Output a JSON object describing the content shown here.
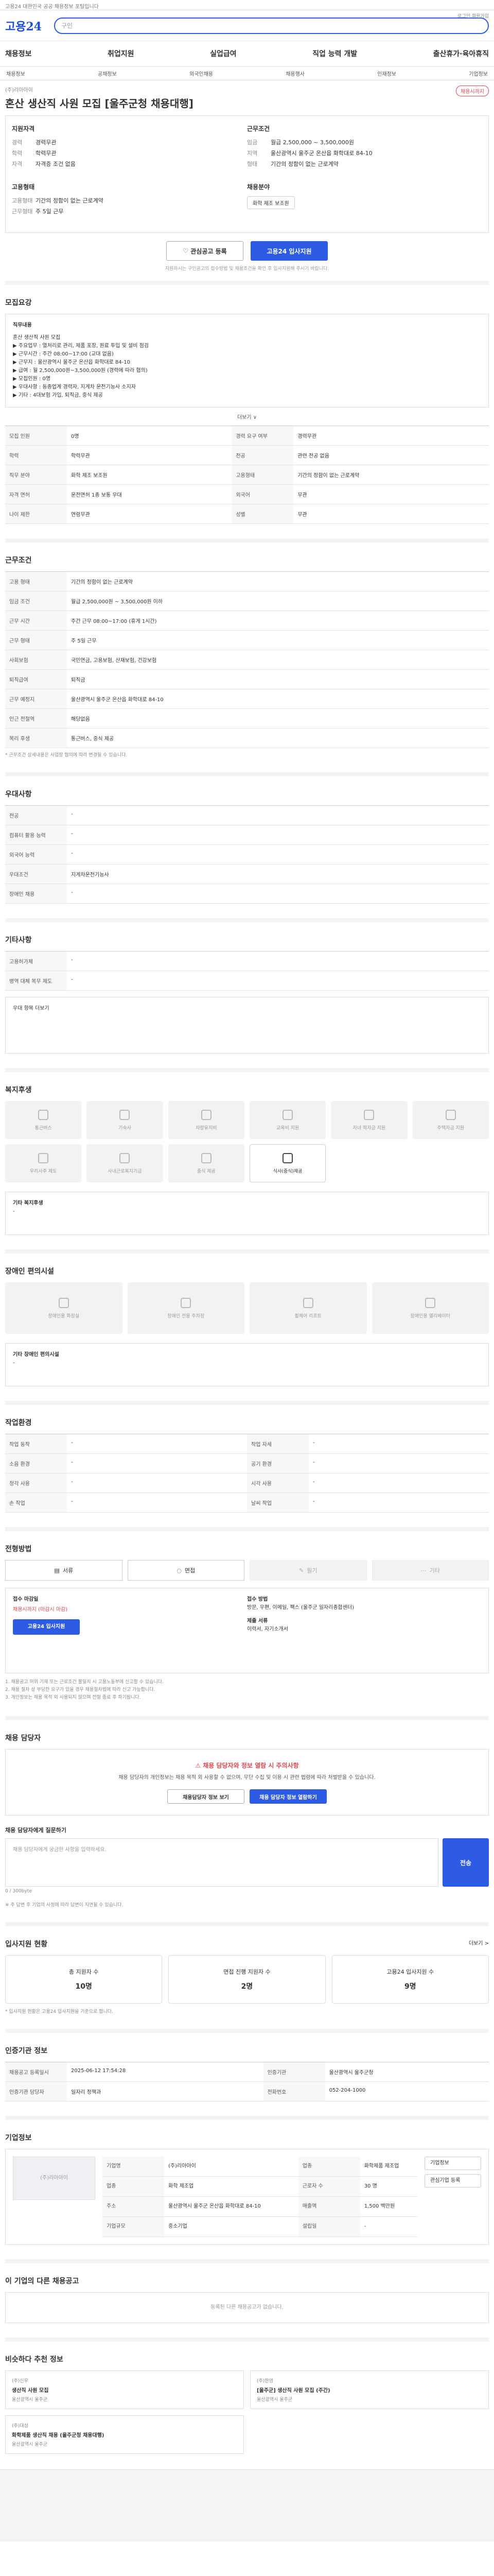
{
  "top": {
    "notice": "고용24 대한민국 공공 채용정보 포털입니다"
  },
  "gnb": {
    "logo": "고용24",
    "search_placeholder": "구인",
    "util": "로그인  회원가입"
  },
  "menu": [
    "채용정보",
    "취업지원",
    "실업급여",
    "직업 능력 개발",
    "출산휴가·육아휴직"
  ],
  "submenu": [
    "채용정보",
    "공채정보",
    "외국인채용",
    "채용행사",
    "인재정보",
    "기업정보"
  ],
  "job": {
    "company": "(주)리아아이",
    "title": "혼산 생산직 사원 모집 [울주군청 채용대행]",
    "deadline": "채용시까지",
    "summary": {
      "h_apply": "지원자격",
      "apply": [
        [
          "경력",
          "경력무관"
        ],
        [
          "학력",
          "학력무관"
        ],
        [
          "자격",
          "자격증 조건 없음"
        ]
      ],
      "h_cond": "근무조건",
      "cond": [
        [
          "임금",
          "월급 2,500,000 ~ 3,500,000원"
        ],
        [
          "지역",
          "울산광역시 울주군 온산읍 화학대로 84-10"
        ],
        [
          "형태",
          "기간의 정함이 없는 근로계약"
        ]
      ],
      "h_co": "고용형태",
      "co": [
        [
          "고용형태",
          "기간의 정함이 없는 근로계약"
        ],
        [
          "근무형태",
          "주 5일 근무"
        ]
      ],
      "h_hire": "채용분야",
      "hire": "화학 제조 보조원"
    },
    "btn_scrap": "관심공고 등록",
    "btn_apply": "고용24 입사지원",
    "note": "지원하시는 구인공고의 접수방법 및 채용조건을 확인 후 입사지원해 주시기 바랍니다."
  },
  "detail": {
    "title": "모집요강",
    "box_title": "직무내용",
    "box": "혼산 생산직 사원 모집\n▶ 주요업무 : 열처리로 관리, 제품 포장, 원료 투입 및 설비 점검\n▶ 근무시간 : 주간 08:00~17:00 (교대 없음)\n▶ 근무지 : 울산광역시 울주군 온산읍 화학대로 84-10\n▶ 급여 : 월 2,500,000원~3,500,000원 (경력에 따라 협의)\n▶ 모집인원 : 0명\n▶ 우대사항 : 동종업계 경력자, 지게차 운전기능사 소지자\n▶ 기타 : 4대보험 가입, 퇴직금, 중식 제공",
    "fold": "더보기 ∨",
    "rows": [
      [
        "모집 인원",
        "0명",
        "경력 요구 여부",
        "경력무관"
      ],
      [
        "학력",
        "학력무관",
        "전공",
        "관련 전공 없음"
      ],
      [
        "직무 분야",
        "화학 제조 보조원",
        "고용형태",
        "기간의 정함이 없는 근로계약"
      ],
      [
        "자격 면허",
        "운전면허 1종 보통 우대",
        "외국어",
        "무관"
      ],
      [
        "나이 제한",
        "연령무관",
        "성별",
        "무관"
      ]
    ]
  },
  "work": {
    "title": "근무조건",
    "rows": [
      [
        "고용 형태",
        "기간의 정함이 없는 근로계약"
      ],
      [
        "임금 조건",
        "월급 2,500,000원 ~ 3,500,000원 이하"
      ],
      [
        "근무 시간",
        "주간 근무 08:00~17:00 (휴게 1시간)"
      ],
      [
        "근무 형태",
        "주 5일 근무"
      ],
      [
        "사회보험",
        "국민연금, 고용보험, 산재보험, 건강보험"
      ],
      [
        "퇴직급여",
        "퇴직금"
      ],
      [
        "근무 예정지",
        "울산광역시 울주군 온산읍 화학대로 84-10"
      ],
      [
        "인근 전철역",
        "해당없음"
      ],
      [
        "복리 후생",
        "통근버스, 중식 제공"
      ]
    ],
    "wage_note": "* 근무조건 상세내용은 사업장 협의에 따라 변경될 수 있습니다."
  },
  "pref": {
    "title": "우대사항",
    "rows": [
      [
        "전공",
        "-"
      ],
      [
        "컴퓨터 활용 능력",
        "-"
      ],
      [
        "외국어 능력",
        "-"
      ],
      [
        "우대조건",
        "지게차운전기능사"
      ],
      [
        "장애인 채용",
        "-"
      ]
    ]
  },
  "etc": {
    "title": "기타사항",
    "rows": [
      [
        "고용허가제",
        "-"
      ],
      [
        "병역 대체 복무 제도",
        "-"
      ]
    ],
    "more": "우대 항목 더보기"
  },
  "welfare": {
    "title": "복지후생",
    "items": [
      "통근버스",
      "기숙사",
      "차량유지비",
      "교육비 지원",
      "자녀 학자금 지원",
      "주택자금 지원",
      "우리사주 제도",
      "사내근로복지기금",
      "중식 제공",
      "식사(중식)제공"
    ],
    "other_title": "기타 복지후생",
    "other": "-"
  },
  "facility": {
    "title": "장애인 편의시설",
    "items": [
      "장애인용 화장실",
      "장애인 전용 주차장",
      "휠체어 리프트",
      "장애인용 엘리베이터"
    ],
    "other_title": "기타 장애인 편의시설",
    "other": "-"
  },
  "env": {
    "title": "작업환경",
    "rows": [
      [
        "작업 동작",
        "-",
        "작업 자세",
        "-"
      ],
      [
        "소음 환경",
        "-",
        "공기 환경",
        "-"
      ],
      [
        "청각 사용",
        "-",
        "시각 사용",
        "-"
      ],
      [
        "손 작업",
        "-",
        "날씨 작업",
        "-"
      ]
    ]
  },
  "method": {
    "title": "전형방법",
    "tabs": [
      "서류",
      "면접",
      "필기",
      "기타"
    ],
    "left_h": "접수 마감일",
    "left_v": "채용시까지 (마감시 마감)",
    "left_b": "고용24 입사지원",
    "right_h": "접수 방법",
    "right_v": "방문, 우편, 이메일, 팩스 (울주군 일자리종합센터)",
    "right_h2": "제출 서류",
    "right_v2": "이력서, 자기소개서",
    "notes": "1. 채용공고 허위 기재 또는 근로조건 불일치 시 고용노동부에 신고할 수 있습니다.\n2. 채용 절차 상 부당한 요구가 있을 경우 채용절차법에 따라 신고 가능합니다.\n3. 개인정보는 채용 목적 외 사용되지 않으며 전형 종료 후 파기됩니다."
  },
  "contact": {
    "title": "채용 담당자",
    "warn": "채용 담당자와 정보 열람 시 주의사항",
    "warn_text": "채용 담당자의 개인정보는 채용 목적 외 사용할 수 없으며, 무단 수집 및 이용 시 관련 법령에 따라 처벌받을 수 있습니다.",
    "b1": "채용담당자 정보 보기",
    "b2": "채용 담당자 정보 열람하기",
    "q_title": "채용 담당자에게 질문하기",
    "q_ph": "채용 담당자에게 궁금한 사항을 입력하세요.",
    "q_btn": "전송",
    "q_count": "0 / 300byte",
    "q_note": "※ 주 답변 후 기업의 사정에 따라 답변이 지연될 수 있습니다."
  },
  "status": {
    "title": "입사지원 현황",
    "more": "더보기 >",
    "items": [
      [
        "총 지원자 수",
        "10명"
      ],
      [
        "면접 진행 지원자 수",
        "2명"
      ],
      [
        "고용24 입사지원 수",
        "9명"
      ]
    ],
    "note": "* 입사지원 현황은 고용24 입사지원을 기준으로 합니다."
  },
  "info": {
    "title": "인증기관 정보",
    "rows": [
      [
        "채용공고 등록일시",
        "2025-06-12 17:54:28",
        "인증기관",
        "울산광역시 울주군청"
      ],
      [
        "인증기관 담당자",
        "일자리 정책과",
        "전화번호",
        "052-204-1000"
      ]
    ]
  },
  "company": {
    "title": "기업정보",
    "name": "(주)리아아이",
    "rows": [
      [
        "기업명",
        "(주)리아아이",
        "업종",
        "화학제품 제조업"
      ],
      [
        "업종",
        "화학 제조업",
        "근로자 수",
        "30 명"
      ],
      [
        "주소",
        "울산광역시 울주군 온산읍 화학대로 84-10",
        "매출액",
        "1,500 백만원"
      ],
      [
        "기업규모",
        "중소기업",
        "설립일",
        "-"
      ]
    ],
    "btn1": "기업정보",
    "btn2": "관심기업 등록"
  },
  "other": {
    "title": "이 기업의 다른 채용공고",
    "empty": "등록된 다른 채용공고가 없습니다."
  },
  "recommend": {
    "title": "비슷하다 추천 정보",
    "cards": [
      {
        "co": "(주)신우",
        "t": "생산직 사원 모집",
        "a": "울산광역시 울주군"
      },
      {
        "co": "(주)한영",
        "t": "[울주군] 생산직 사원 모집 (주간)",
        "a": "울산광역시 울주군"
      },
      {
        "co": "(주)대성",
        "t": "화학제품 생산직 채용 (울주군청 채용대행)",
        "a": "울산광역시 울주군"
      }
    ]
  }
}
